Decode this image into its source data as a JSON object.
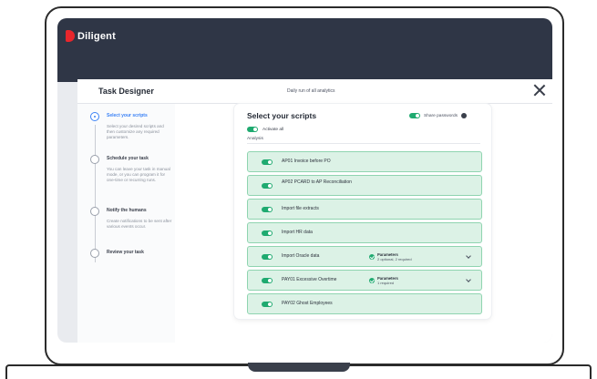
{
  "app": {
    "brand": "Diligent"
  },
  "dialog": {
    "title": "Task Designer",
    "subtitle": "Daily run of all analytics"
  },
  "steps": [
    {
      "title": "Select your scripts",
      "desc": "Select your desired scripts and then customize any required parameters.",
      "active": true
    },
    {
      "title": "Schedule your task",
      "desc": "You can leave your task in manual mode, or you can program it for one-time or recurring runs."
    },
    {
      "title": "Notify the humans",
      "desc": "Create notifications to be sent after various events occur."
    },
    {
      "title": "Review your task",
      "desc": ""
    }
  ],
  "panel": {
    "title": "Select your scripts",
    "share_label": "Share passwords",
    "activate_label": "Activate all",
    "section_label": "Analysis",
    "scripts": [
      {
        "name": "AP01 Invoice before PO"
      },
      {
        "name": "AP02 PCARD to AP Reconciliation"
      },
      {
        "name": "Import file extracts"
      },
      {
        "name": "Import HR data"
      },
      {
        "name": "Import Oracle data",
        "param_title": "Parameters",
        "param_sub": "2 optional, 2 required"
      },
      {
        "name": "PAY01 Excessive Overtime",
        "param_title": "Parameters",
        "param_sub": "1 required"
      },
      {
        "name": "PAY02 Ghost Employees"
      }
    ]
  },
  "colors": {
    "header": "#2f3646",
    "accent": "#3b82f6",
    "toggle_on": "#1faa70",
    "row_bg": "#dcf2e6",
    "brand_red": "#e8262c"
  }
}
